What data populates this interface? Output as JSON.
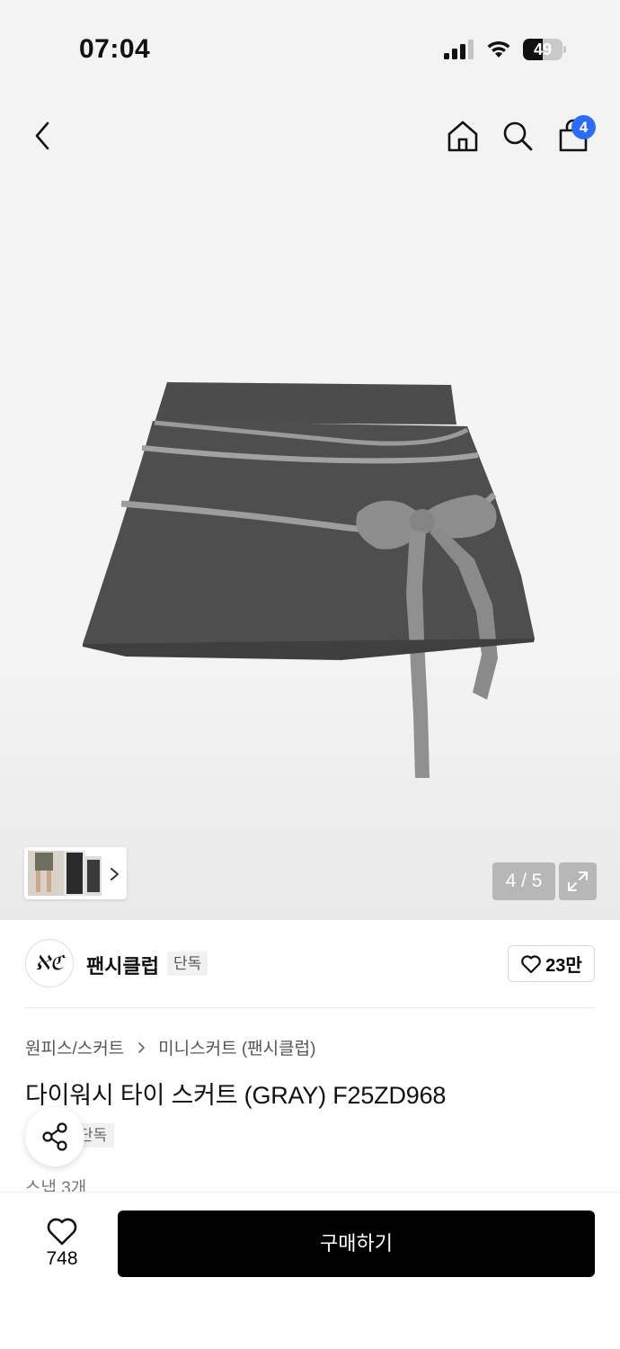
{
  "status_bar": {
    "time": "07:04",
    "battery": "49",
    "battery_level_percent": 49
  },
  "header": {
    "icons": [
      "back-icon",
      "home-icon",
      "search-icon",
      "cart-icon"
    ],
    "cart_count": "4"
  },
  "gallery": {
    "counter": "4 / 5",
    "thumbnail_count": 3
  },
  "brand": {
    "logo_text": "ℵℭ",
    "name": "팬시클럽",
    "exclusive_badge": "단독",
    "likes": "23만"
  },
  "product": {
    "breadcrumb": [
      "원피스/스커트",
      "미니스커트 (팬시클럽)"
    ],
    "title": "다이워시 타이 스커트 (GRAY) F25ZD968",
    "partial_badge": "단독",
    "snap_count": "스냅 3개"
  },
  "bottom_bar": {
    "wish_count": "748",
    "buy_label": "구매하기"
  },
  "colors": {
    "badge_blue": "#2c6cf6",
    "button_black": "#000000"
  }
}
